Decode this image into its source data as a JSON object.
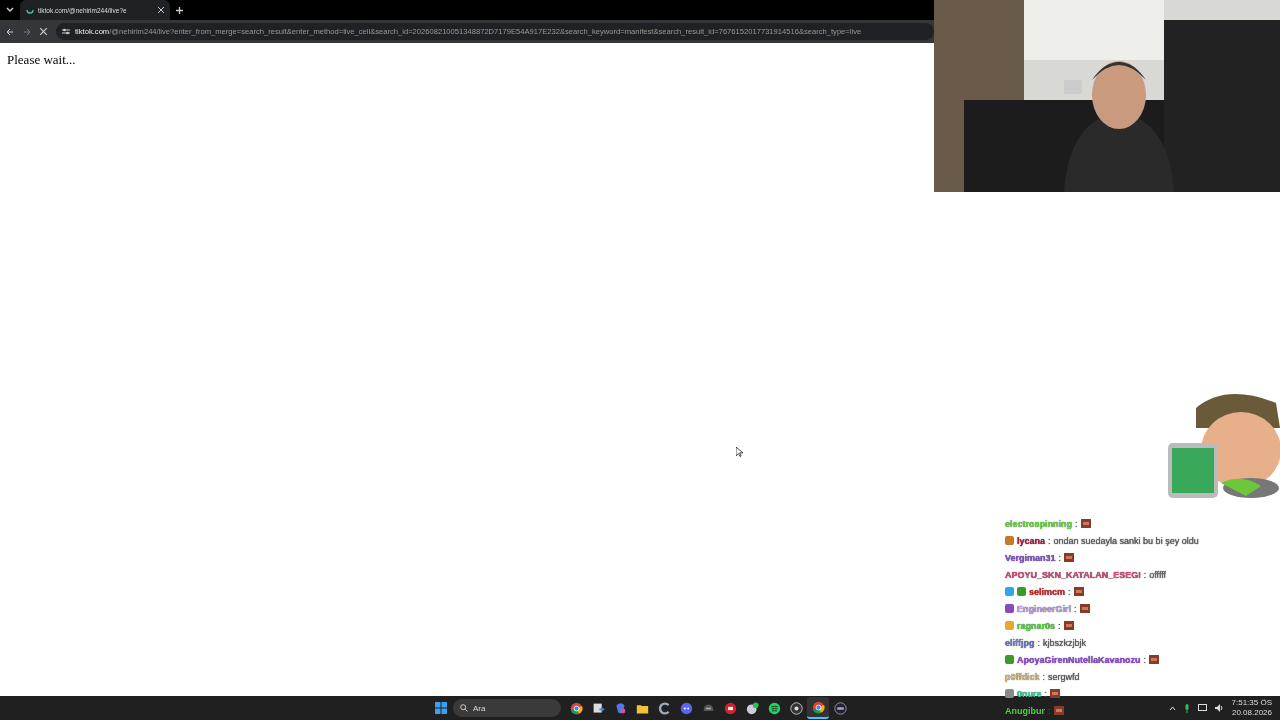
{
  "browser": {
    "tab": {
      "title": "tiktok.com/@nehirim244/live?e",
      "loading": true
    },
    "url": {
      "host": "tiktok.com",
      "path": "/@nehirim244/live?enter_from_merge=search_result&enter_method=live_cell&search_id=202608210051348872D7179E54A917E232&search_keyword=manifest&search_result_id=7676152017731914516&search_type=live"
    },
    "page_text": "Please wait..."
  },
  "chat": [
    {
      "user": "electrospinning",
      "color": "#6fdc4a",
      "sep": ":",
      "emote": true
    },
    {
      "user": "lycana",
      "color": "#c0143c",
      "badges": [
        {
          "color": "#c8782a"
        }
      ],
      "sep": ":",
      "message": "ondan suedayla sanki bu bi şey oldu"
    },
    {
      "user": "Vergiman31",
      "color": "#8a55d8",
      "sep": ":",
      "emote": true
    },
    {
      "user": "APOYU_SKN_KATALAN_ESEGI",
      "color": "#d84a78",
      "sep": ":",
      "message": "offfff"
    },
    {
      "user": "selimcm",
      "color": "#d8282a",
      "badges": [
        {
          "color": "#2aa8e8"
        },
        {
          "color": "#3a9a2a"
        }
      ],
      "sep": ":",
      "emote": true
    },
    {
      "user": "EngineerGirl",
      "color": "#c8a0e8",
      "badges": [
        {
          "color": "#8a4ab8"
        }
      ],
      "sep": ":",
      "emote": true
    },
    {
      "user": "ragnar0s",
      "color": "#5ad84a",
      "badges": [
        {
          "color": "#e8a82a"
        }
      ],
      "sep": ":",
      "emote": true
    },
    {
      "user": "eliffjpg",
      "color": "#6a7ad8",
      "sep": ":",
      "message": "kjbszkzjbjk"
    },
    {
      "user": "ApoyaGirenNutellaKavanozu",
      "color": "#9a4ae8",
      "badges": [
        {
          "color": "#3a9a2a"
        }
      ],
      "sep": ":",
      "emote": true
    },
    {
      "user": "p0ffdick",
      "color": "#d8c07a",
      "sep": ":",
      "message": "sergwfd"
    },
    {
      "user": "0nure",
      "color": "#3ad8a0",
      "badges": [
        {
          "color": "#8a8a8a"
        }
      ],
      "sep": ":",
      "emote": true
    },
    {
      "user": "Anugibur",
      "color": "#5ad84a",
      "sep": ":",
      "emote": true
    }
  ],
  "taskbar": {
    "search": {
      "placeholder": "Ara"
    },
    "apps": [
      {
        "kind": "chrome",
        "active": false
      },
      {
        "kind": "snip",
        "active": false
      },
      {
        "kind": "copilot",
        "active": false
      },
      {
        "kind": "folder",
        "active": false
      },
      {
        "kind": "c",
        "active": false
      },
      {
        "kind": "discord",
        "active": false
      },
      {
        "kind": "helmet",
        "active": false
      },
      {
        "kind": "red",
        "active": false
      },
      {
        "kind": "check",
        "active": false
      },
      {
        "kind": "spotify",
        "active": false
      },
      {
        "kind": "obs",
        "active": false
      },
      {
        "kind": "chrome",
        "active": true
      },
      {
        "kind": "bar",
        "active": false
      }
    ],
    "time": "7:51:35 ÖS",
    "date": "20.08.2026"
  }
}
